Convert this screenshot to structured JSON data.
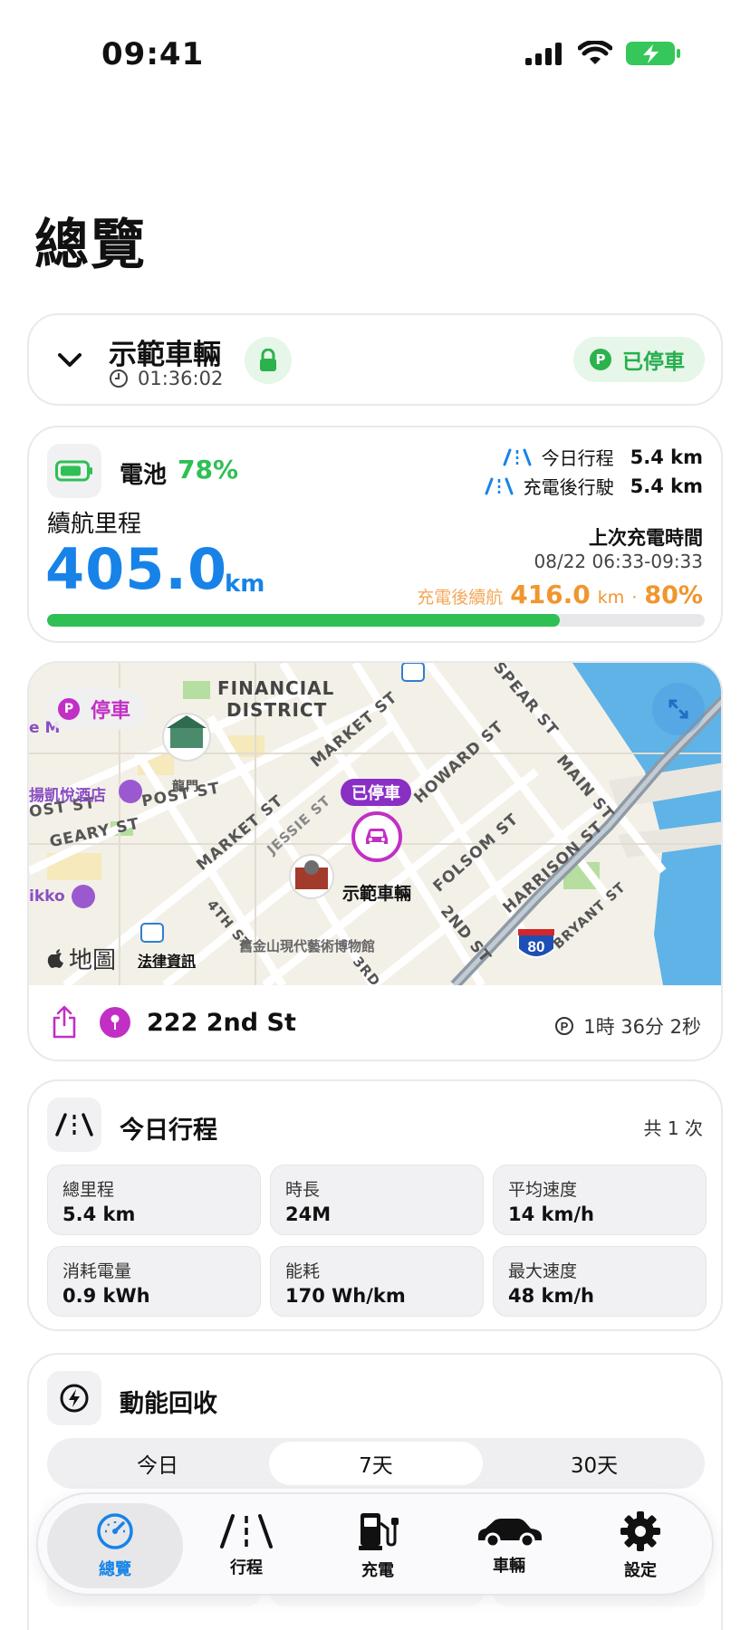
{
  "status_bar": {
    "time": "09:41"
  },
  "page": {
    "title": "總覽"
  },
  "vehicle": {
    "name": "示範車輛",
    "timer": "01:36:02",
    "state_label": "已停車",
    "state_badge": "P"
  },
  "battery": {
    "label": "電池",
    "percent_text": "78%",
    "percent_value": 78,
    "today_trip_label": "今日行程",
    "today_trip_value": "5.4 km",
    "since_charge_label": "充電後行駛",
    "since_charge_value": "5.4 km",
    "range_label": "續航里程",
    "range_value": "405.0",
    "range_unit": "km",
    "last_charge_label": "上次充電時間",
    "last_charge_time": "08/22 06:33-09:33",
    "after_charge_label": "充電後續航",
    "after_charge_value": "416.0",
    "after_charge_unit": "km",
    "after_charge_sep": "·",
    "after_charge_percent": "80%",
    "colors": {
      "range": "#1783e8",
      "battery": "#2fbf55",
      "charge": "#f0962e"
    }
  },
  "map": {
    "pill_label": "停車",
    "pill_badge": "P",
    "parked_tag": "已停車",
    "car_label": "示範車輛",
    "logo_text": "地圖",
    "legal_text": "法律資訊",
    "labels": {
      "financial": "FINANCIAL",
      "district": "DISTRICT",
      "market_st_1": "MARKET ST",
      "market_st_2": "MARKET ST",
      "spear_st": "SPEAR ST",
      "howard_st": "HOWARD ST",
      "main_st": "MAIN ST",
      "post_st": "POST ST",
      "post_st_2": "OST ST",
      "geary_st": "GEARY ST",
      "jessie_st": "JESSIE ST",
      "folsom_st": "FOLSOM ST",
      "harrison_st": "HARRISON ST",
      "bryant_st": "BRYANT ST",
      "second_st": "2ND ST",
      "fourth_st": "4TH ST",
      "third_st": "3RD",
      "dragon_gate": "龍門",
      "hotel": "揚凱悅酒店",
      "hotel_edge": "e M",
      "nikko": "ikko",
      "museum": "舊金山現代藝術博物館",
      "highway": "80"
    },
    "address": "222 2nd St",
    "duration_badge": "P",
    "duration": "1時 36分 2秒"
  },
  "today_trip": {
    "title": "今日行程",
    "count": "共 1 次",
    "stats": [
      {
        "label": "總里程",
        "value": "5.4 km"
      },
      {
        "label": "時長",
        "value": "24M"
      },
      {
        "label": "平均速度",
        "value": "14 km/h"
      },
      {
        "label": "消耗電量",
        "value": "0.9 kWh"
      },
      {
        "label": "能耗",
        "value": "170 Wh/km"
      },
      {
        "label": "最大速度",
        "value": "48 km/h"
      }
    ]
  },
  "regen": {
    "title": "動能回收",
    "segments": [
      "今日",
      "7天",
      "30天"
    ],
    "active_segment": "7天"
  },
  "tab_bar": {
    "items": [
      {
        "label": "總覽",
        "icon": "gauge-icon"
      },
      {
        "label": "行程",
        "icon": "road-icon"
      },
      {
        "label": "充電",
        "icon": "fuel-pump-icon"
      },
      {
        "label": "車輛",
        "icon": "car-icon"
      },
      {
        "label": "設定",
        "icon": "gear-icon"
      }
    ],
    "active": "總覽"
  }
}
